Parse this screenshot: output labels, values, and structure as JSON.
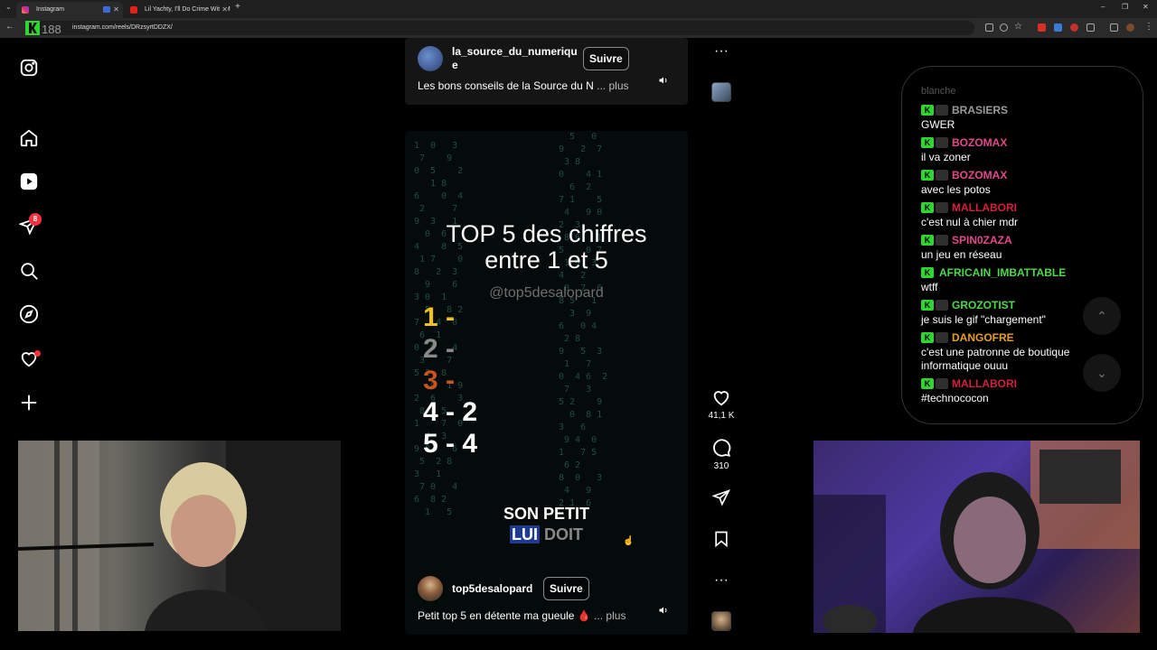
{
  "browser": {
    "tabs": [
      {
        "title": "Instagram",
        "active": true
      },
      {
        "title": "Lil Yachty, I'll Do Crime With M",
        "active": false
      }
    ],
    "url": "instagram.com/reels/DRzsyrtDDZX/",
    "logo_text": "K 188"
  },
  "sidebar": {
    "items": [
      "instagram-logo",
      "home",
      "reels",
      "messages",
      "search",
      "explore",
      "notifications",
      "create"
    ],
    "messages_badge": "8"
  },
  "reel_top": {
    "username": "la_source_du_numerique",
    "username_line1": "la_source_du_numeriqu",
    "username_line2": "e",
    "follow_label": "Suivre",
    "caption": "Les bons conseils de la Source du N",
    "more_label": "... plus"
  },
  "reel_main": {
    "title_line1": "TOP 5 des chiffres",
    "title_line2": "entre 1 et 5",
    "handle": "@top5desalopard",
    "ranks": [
      {
        "text": "1 -",
        "color": "#f2c21b"
      },
      {
        "text": "2 -",
        "color": "#8a8a8a"
      },
      {
        "text": "3 -",
        "color": "#c9531f"
      },
      {
        "text": "4 - 2",
        "color": "#ffffff"
      },
      {
        "text": "5 - 4",
        "color": "#ffffff"
      }
    ],
    "subtitle_line1": "SON PETIT",
    "subtitle_highlight": "LUI",
    "subtitle_dim": "DOIT",
    "username": "top5desalopard",
    "follow_label": "Suivre",
    "caption": "Petit top 5 en détente ma gueule 🩸",
    "more_label": "... plus"
  },
  "actions": {
    "likes": "41,1 K",
    "comments": "310"
  },
  "chat": {
    "faded_text": "blanche",
    "messages": [
      {
        "user": "BRASIERS",
        "color": "#9a9a9a",
        "text": "GWER"
      },
      {
        "user": "BOZOMAX",
        "color": "#e04a8a",
        "text": "il va zoner"
      },
      {
        "user": "BOZOMAX",
        "color": "#e04a8a",
        "text": "avec les potos"
      },
      {
        "user": "MALLABORI",
        "color": "#d0213d",
        "text": "c'est nul à chier mdr"
      },
      {
        "user": "SPIN0ZAZA",
        "color": "#e04a8a",
        "text": "un jeu en réseau"
      },
      {
        "user": "AFRICAIN_IMBATTABLE",
        "color": "#4cd94c",
        "text": "wtff"
      },
      {
        "user": "GROZOTIST",
        "color": "#4cd94c",
        "text": "je suis le gif \"chargement\""
      },
      {
        "user": "DANGOFRE",
        "color": "#e8a020",
        "text": "c'est une patronne de boutique",
        "text2": "informatique ouuu"
      },
      {
        "user": "MALLABORI",
        "color": "#d0213d",
        "text": "#technococon"
      }
    ]
  },
  "colors": {
    "accent_red": "#ff3040",
    "kick_green": "#2fd62f"
  }
}
